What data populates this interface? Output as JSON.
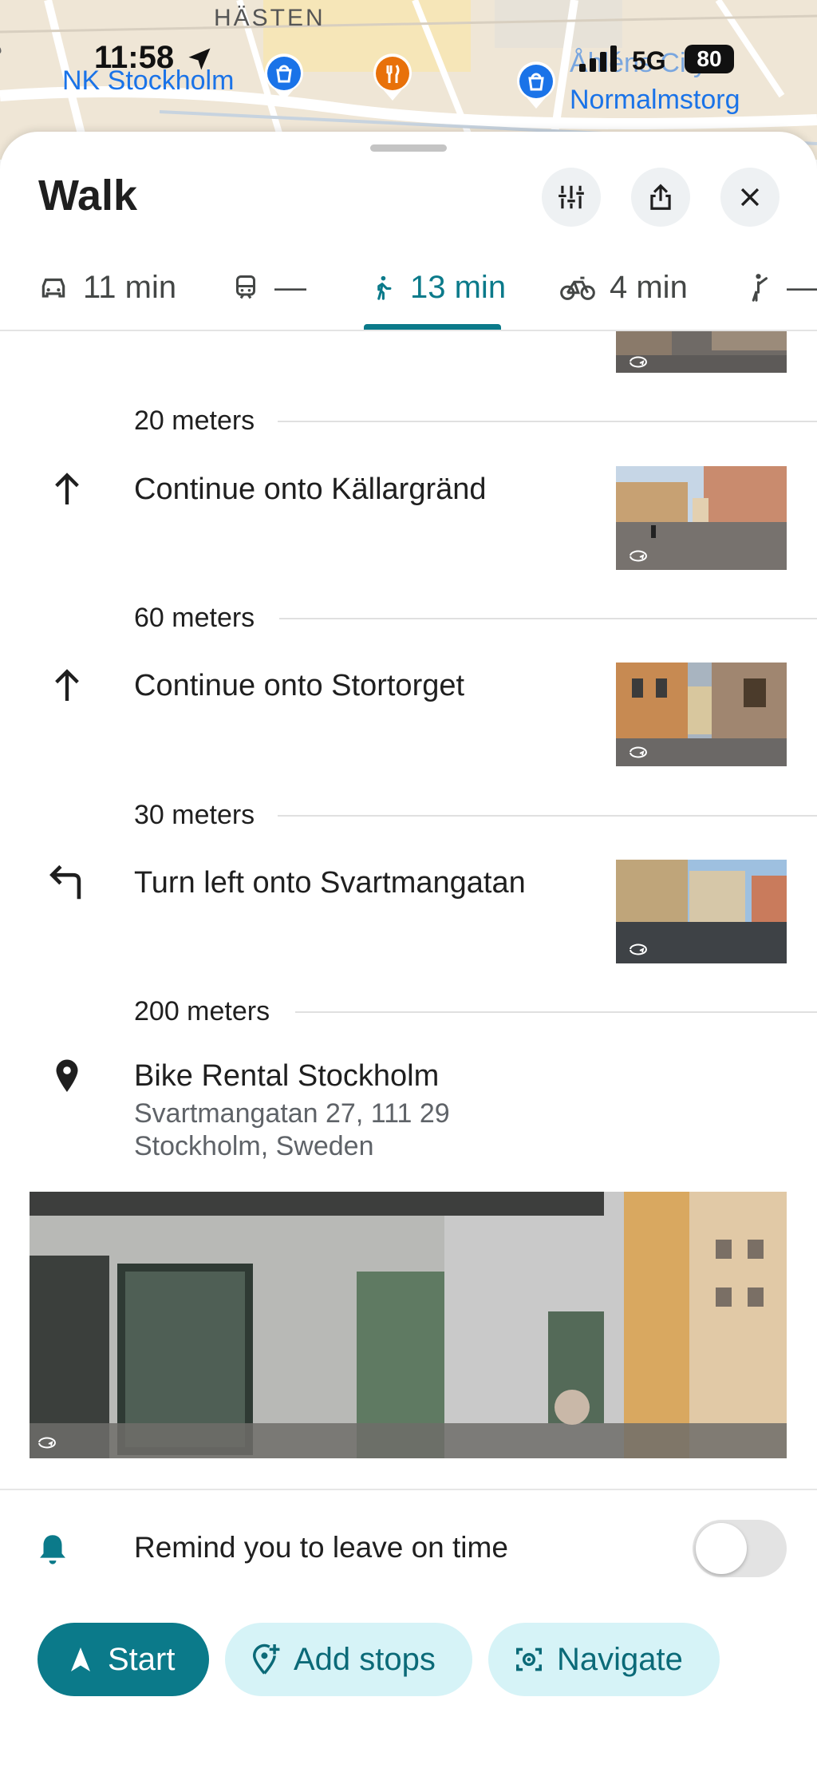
{
  "status_bar": {
    "time": "11:58",
    "network": "5G",
    "battery": "80"
  },
  "map": {
    "labels": {
      "district": "HÄSTEN",
      "street_left": "gen",
      "poi_left": "NK Stockholm",
      "poi_right_1": "Åhléns City",
      "poi_right_2": "Normalmstorg"
    }
  },
  "header": {
    "title": "Walk"
  },
  "modes": [
    {
      "icon": "car-icon",
      "label": "11 min"
    },
    {
      "icon": "transit-icon",
      "label": "—"
    },
    {
      "icon": "walk-icon",
      "label": "13 min",
      "active": true
    },
    {
      "icon": "bike-icon",
      "label": "4 min"
    },
    {
      "icon": "ride-icon",
      "label": "—"
    }
  ],
  "steps": [
    {
      "distance": "20 meters",
      "icon": "arrow-up-icon",
      "text": "Continue onto Källargränd"
    },
    {
      "distance": "60 meters",
      "icon": "arrow-up-icon",
      "text": "Continue onto Stortorget"
    },
    {
      "distance": "30 meters",
      "icon": "turn-left-icon",
      "text": "Turn left onto Svartmangatan"
    }
  ],
  "destination": {
    "distance": "200 meters",
    "name": "Bike Rental Stockholm",
    "address_line1": "Svartmangatan 27, 111 29",
    "address_line2": "Stockholm, Sweden"
  },
  "reminder": {
    "label": "Remind you to leave on time",
    "enabled": false
  },
  "actions": {
    "start": "Start",
    "add_stops": "Add stops",
    "navigate": "Navigate"
  },
  "colors": {
    "accent": "#0b7a8a",
    "accent_light": "#d6f3f7",
    "map_bg": "#efe6d6",
    "poi_blue": "#1a73e8",
    "poi_orange": "#e8710a"
  }
}
